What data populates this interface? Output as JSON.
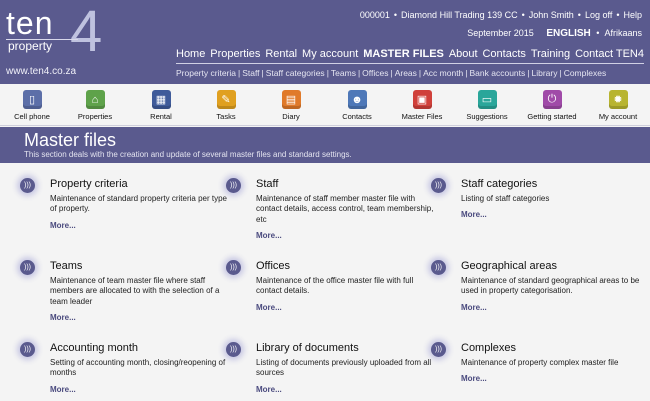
{
  "brand": {
    "logo_main": "ten",
    "logo_digit": "4",
    "logo_sub": "property",
    "url": "www.ten4.co.za"
  },
  "topbar": {
    "client_code": "000001",
    "company": "Diamond Hill Trading 139 CC",
    "user": "John Smith",
    "logoff": "Log off",
    "help": "Help"
  },
  "dateline": {
    "date": "September 2015",
    "lang_selected": "ENGLISH",
    "lang_other": "Afrikaans"
  },
  "main_nav": [
    "Home",
    "Properties",
    "Rental",
    "My account",
    "MASTER FILES",
    "About",
    "Contacts",
    "Training",
    "Contact TEN4"
  ],
  "sub_nav": [
    "Property criteria",
    "Staff",
    "Staff categories",
    "Teams",
    "Offices",
    "Areas",
    "Acc month",
    "Bank accounts",
    "Library",
    "Complexes"
  ],
  "toolbar": [
    {
      "label": "Cell phone",
      "icon": "cellphone-icon",
      "color": "#5c6fa8"
    },
    {
      "label": "Properties",
      "icon": "house-icon",
      "color": "#5ea24a"
    },
    {
      "label": "Rental",
      "icon": "building-icon",
      "color": "#3f5b9a"
    },
    {
      "label": "Tasks",
      "icon": "pin-icon",
      "color": "#e0a020"
    },
    {
      "label": "Diary",
      "icon": "calendar-icon",
      "color": "#e07a2a"
    },
    {
      "label": "Contacts",
      "icon": "person-icon",
      "color": "#4e78b8"
    },
    {
      "label": "Master Files",
      "icon": "folder-icon",
      "color": "#d0403a"
    },
    {
      "label": "Suggestions",
      "icon": "speech-icon",
      "color": "#2aa69a"
    },
    {
      "label": "Getting started",
      "icon": "power-icon",
      "color": "#a04aa8"
    },
    {
      "label": "My account",
      "icon": "gear-icon",
      "color": "#b8b430"
    }
  ],
  "page": {
    "title": "Master files",
    "subtitle": "This section deals with the creation and update of several master files and standard settings."
  },
  "more_label": "More...",
  "items": [
    {
      "title": "Property criteria",
      "desc": "Maintenance of standard property criteria per type of property."
    },
    {
      "title": "Staff",
      "desc": "Maintenance of staff member master file with contact details, access control, team membership, etc"
    },
    {
      "title": "Staff categories",
      "desc": "Listing of staff categories"
    },
    {
      "title": "Teams",
      "desc": "Maintenance of team master file where staff members are allocated to with the selection of a team leader"
    },
    {
      "title": "Offices",
      "desc": "Maintenance of the office master file with full contact details."
    },
    {
      "title": "Geographical areas",
      "desc": "Maintenance of standard geographical areas to be used in property categorisation."
    },
    {
      "title": "Accounting month",
      "desc": "Setting of accounting month, closing/reopening of months"
    },
    {
      "title": "Library of documents",
      "desc": "Listing of documents previously uploaded from all sources"
    },
    {
      "title": "Complexes",
      "desc": "Maintenance of property complex master file"
    }
  ]
}
